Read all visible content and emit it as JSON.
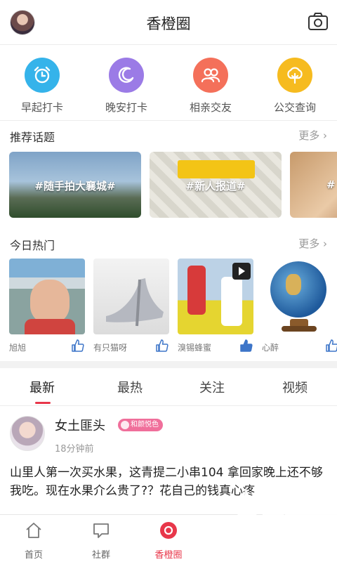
{
  "header": {
    "title": "香橙圈"
  },
  "shortcuts": [
    {
      "label": "早起打卡",
      "icon": "alarm-clock-icon",
      "color": "#35b3ea"
    },
    {
      "label": "晚安打卡",
      "icon": "moon-icon",
      "color": "#9b7be6"
    },
    {
      "label": "相亲交友",
      "icon": "people-icon",
      "color": "#f4705a"
    },
    {
      "label": "公交查询",
      "icon": "tree-icon",
      "color": "#f6bb1f"
    }
  ],
  "topics_section": {
    "title": "推荐话题",
    "more": "更多"
  },
  "topics": [
    {
      "label": "#随手拍大襄城#"
    },
    {
      "label": "#新人报道#"
    },
    {
      "label": "#"
    }
  ],
  "hot_section": {
    "title": "今日热门",
    "more": "更多"
  },
  "hot": [
    {
      "name": "旭旭",
      "liked": false
    },
    {
      "name": "有只猫呀",
      "liked": false
    },
    {
      "name": "溴锡蜂蜜",
      "liked": true
    },
    {
      "name": "心醉",
      "liked": false
    }
  ],
  "tabs": [
    {
      "label": "最新",
      "active": true
    },
    {
      "label": "最热",
      "active": false
    },
    {
      "label": "关注",
      "active": false
    },
    {
      "label": "视频",
      "active": false
    }
  ],
  "post": {
    "user": "女土匪头",
    "badge": "和颜悦色",
    "time": "18分钟前",
    "text": "山里人第一次买水果，这青提二小串104  拿回家晚上还不够我吃。现在水果介么贵了?？花自己的钱真心疼"
  },
  "bottom_nav": [
    {
      "label": "首页",
      "icon": "home-icon",
      "active": false
    },
    {
      "label": "社群",
      "icon": "chat-icon",
      "active": false
    },
    {
      "label": "香橙圈",
      "icon": "orange-circle-icon",
      "active": true
    }
  ],
  "colors": {
    "accent": "#e8374a",
    "badge": "#f06f9b"
  }
}
